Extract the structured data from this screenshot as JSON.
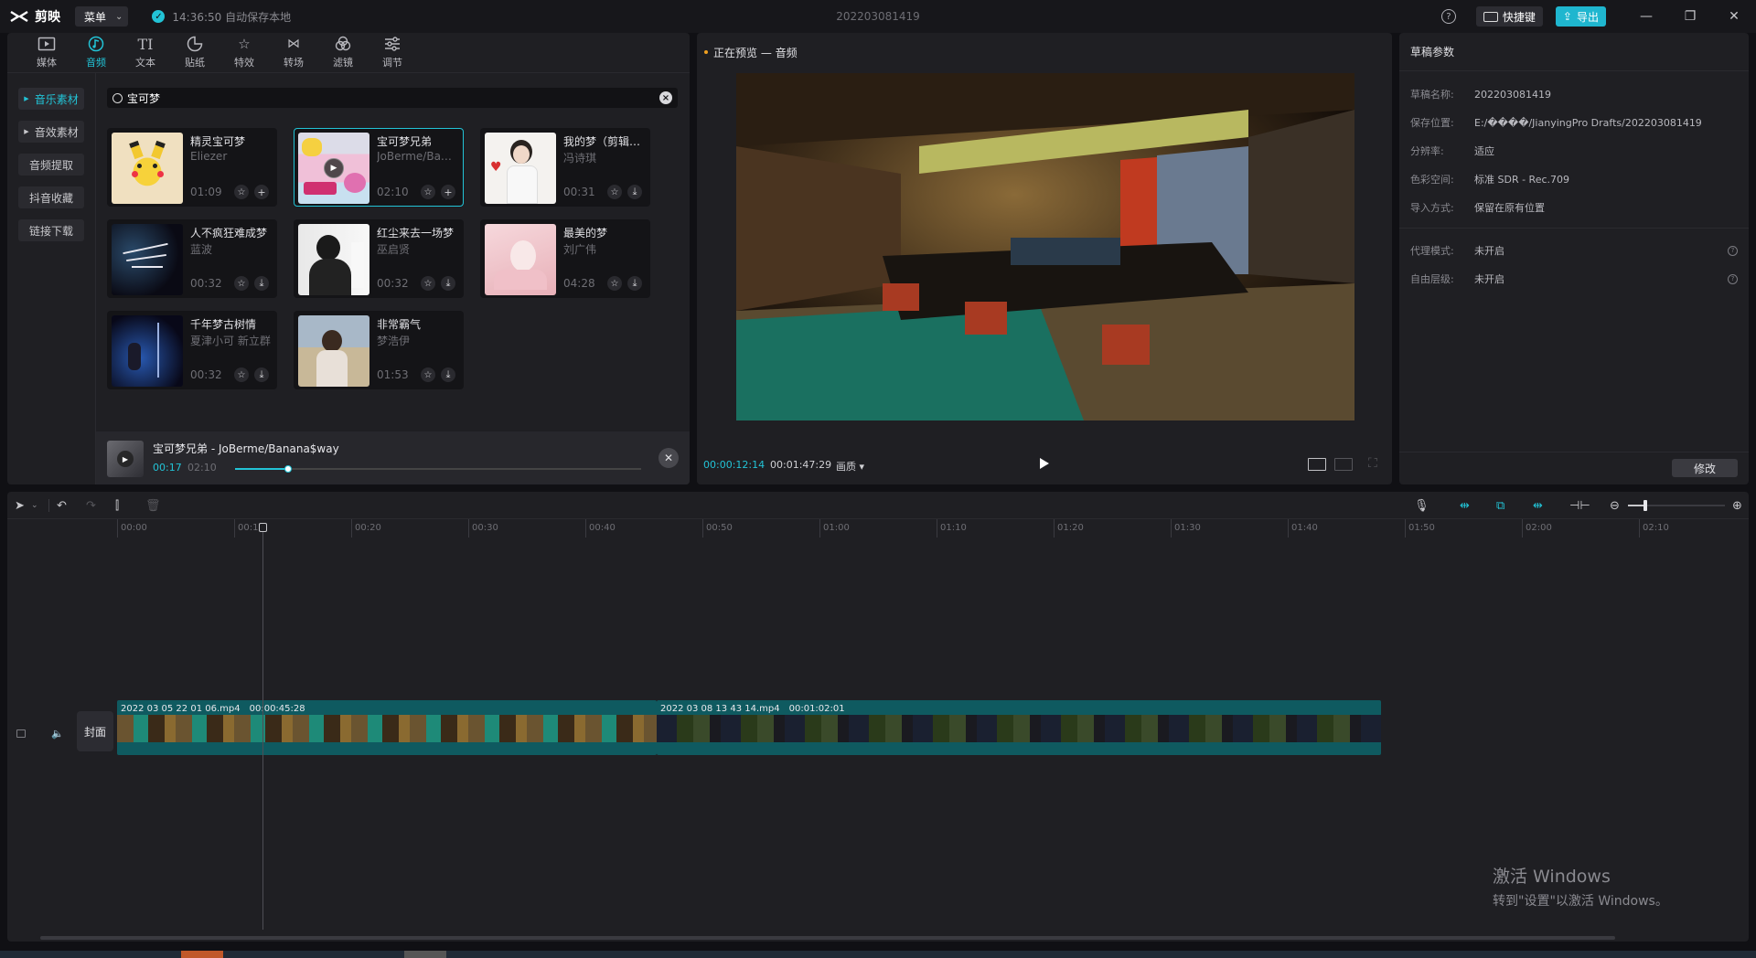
{
  "titlebar": {
    "app_name": "剪映",
    "menu_label": "菜单",
    "autosave_text": "14:36:50 自动保存本地",
    "project_name": "202203081419",
    "shortcut_label": "快捷键",
    "export_label": "导出"
  },
  "toolbar": {
    "tools": [
      {
        "label": "媒体",
        "icon": "media-icon"
      },
      {
        "label": "音频",
        "icon": "audio-icon"
      },
      {
        "label": "文本",
        "icon": "text-icon"
      },
      {
        "label": "贴纸",
        "icon": "sticker-icon"
      },
      {
        "label": "特效",
        "icon": "effects-icon"
      },
      {
        "label": "转场",
        "icon": "transition-icon"
      },
      {
        "label": "滤镜",
        "icon": "filter-icon"
      },
      {
        "label": "调节",
        "icon": "adjust-icon"
      }
    ],
    "active": "音频"
  },
  "audio_sidebar": {
    "items": [
      "音乐素材",
      "音效素材",
      "音频提取",
      "抖音收藏",
      "链接下载"
    ],
    "active": "音乐素材"
  },
  "search": {
    "query": "宝可梦"
  },
  "songs": [
    {
      "title": "精灵宝可梦",
      "artist": "Eliezer",
      "duration": "01:09",
      "action": "+"
    },
    {
      "title": "宝可梦兄弟",
      "artist": "JoBerme/Banana$way",
      "duration": "02:10",
      "action": "+"
    },
    {
      "title": "我的梦（剪辑版）",
      "artist": "冯诗琪",
      "duration": "00:31",
      "action": "download"
    },
    {
      "title": "人不疯狂难成梦",
      "artist": "蓝波",
      "duration": "00:32",
      "action": "download"
    },
    {
      "title": "红尘来去一场梦",
      "artist": "巫启贤",
      "duration": "00:32",
      "action": "download"
    },
    {
      "title": "最美的梦",
      "artist": "刘广伟",
      "duration": "04:28",
      "action": "download"
    },
    {
      "title": "千年梦古树情",
      "artist": "夏津小可 新立群",
      "duration": "00:32",
      "action": "download"
    },
    {
      "title": "非常霸气",
      "artist": "梦浩伊",
      "duration": "01:53",
      "action": "download"
    }
  ],
  "audio_player": {
    "title": "宝可梦兄弟 - JoBerme/Banana$way",
    "current": "00:17",
    "total": "02:10",
    "progress": 0.13
  },
  "preview": {
    "header": "正在预览 — 音频",
    "current": "00:00:12:14",
    "total": "00:01:47:29",
    "quality": "画质"
  },
  "draft": {
    "header": "草稿参数",
    "rows": [
      {
        "key": "草稿名称:",
        "value": "202203081419"
      },
      {
        "key": "保存位置:",
        "value": "E:/����/JianyingPro Drafts/202203081419"
      },
      {
        "key": "分辨率:",
        "value": "适应"
      },
      {
        "key": "色彩空间:",
        "value": "标准 SDR - Rec.709"
      },
      {
        "key": "导入方式:",
        "value": "保留在原有位置"
      },
      {
        "key": "代理模式:",
        "value": "未开启"
      },
      {
        "key": "自由层级:",
        "value": "未开启"
      }
    ],
    "edit_label": "修改"
  },
  "timeline": {
    "ruler": [
      "00:00",
      "00:10",
      "00:20",
      "00:30",
      "00:40",
      "00:50",
      "01:00",
      "01:10",
      "01:20",
      "01:30",
      "01:40",
      "01:50",
      "02:00",
      "02:10"
    ],
    "cover_label": "封面",
    "clips": [
      {
        "name": "2022 03 05 22 01 06.mp4",
        "duration": "00:00:45:28"
      },
      {
        "name": "2022 03 08 13 43 14.mp4",
        "duration": "00:01:02:01"
      }
    ]
  },
  "watermark": {
    "line1": "激活 Windows",
    "line2": "转到\"设置\"以激活 Windows。"
  },
  "colors": {
    "accent": "#22c3d6",
    "panel": "#1f1f23",
    "background": "#101014",
    "clip": "#0f5a60"
  }
}
